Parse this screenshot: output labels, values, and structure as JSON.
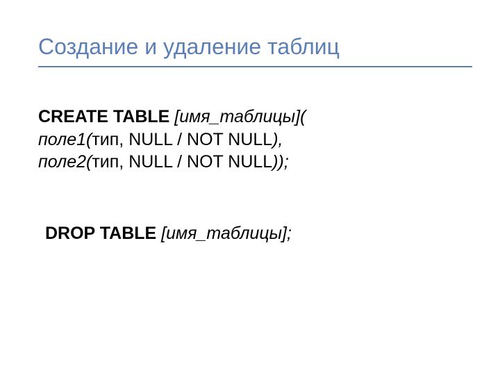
{
  "header": {
    "title": "Создание  и удаление таблиц"
  },
  "content": {
    "create": {
      "keyword": "CREATE TABLE",
      "italic_after_keyword": " [имя_таблицы](",
      "line2_italic_start": "поле1(",
      "line2_plain": "тип, NULL / NOT NULL",
      "line2_italic_end": "),",
      "line3_italic_start": "поле2(",
      "line3_plain": "тип, NULL / NOT NULL",
      "line3_italic_end": "));"
    },
    "drop": {
      "keyword": "DROP TABLE",
      "italic_after_keyword": " [имя_таблицы];"
    }
  }
}
